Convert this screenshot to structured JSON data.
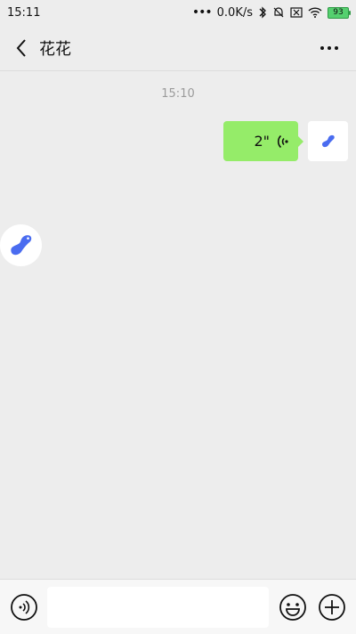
{
  "status_bar": {
    "time": "15:11",
    "network_speed": "0.0K/s",
    "battery": "93",
    "icons": [
      "more-dots-icon",
      "bluetooth-icon",
      "mute-icon",
      "no-sim-icon",
      "wifi-icon",
      "battery-icon"
    ]
  },
  "header": {
    "title": "花花",
    "back_icon": "back-arrow-icon",
    "more_icon": "more-dots-icon"
  },
  "chat": {
    "timestamp": "15:10",
    "messages": [
      {
        "sender": "me",
        "type": "voice",
        "duration": "2\"",
        "bubble_color": "#95ec69"
      }
    ]
  },
  "input_bar": {
    "voice_icon": "voice-toggle-icon",
    "emoji_icon": "emoji-icon",
    "plus_icon": "plus-icon",
    "text_value": ""
  },
  "colors": {
    "background": "#ededed",
    "bubble": "#95ec69",
    "avatar_blob": "#4a6cf0"
  }
}
